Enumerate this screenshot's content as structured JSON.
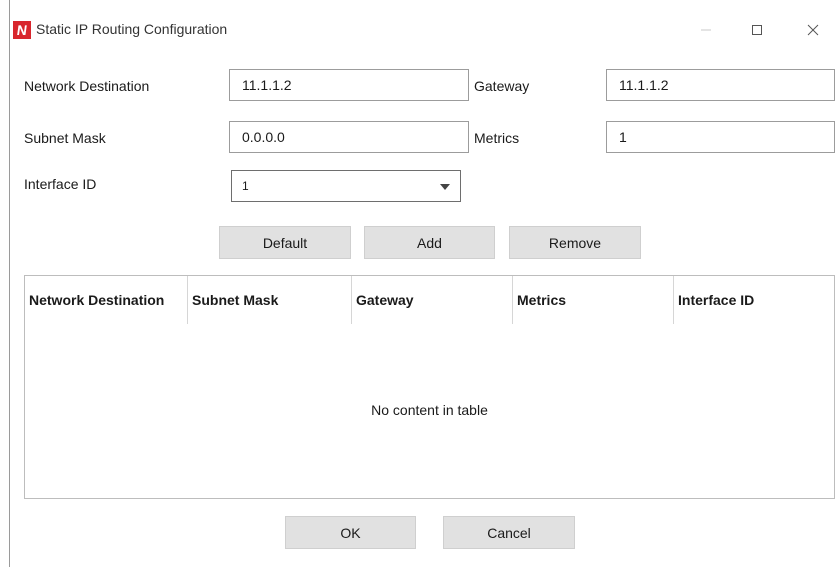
{
  "window": {
    "title": "Static IP Routing Configuration"
  },
  "form": {
    "network_destination": {
      "label": "Network Destination",
      "value": "11.1.1.2"
    },
    "gateway": {
      "label": "Gateway",
      "value": "11.1.1.2"
    },
    "subnet_mask": {
      "label": "Subnet Mask",
      "value": "0.0.0.0"
    },
    "metrics": {
      "label": "Metrics",
      "value": "1"
    },
    "interface_id": {
      "label": "Interface ID",
      "value": "1"
    }
  },
  "actions": {
    "default_label": "Default",
    "add_label": "Add",
    "remove_label": "Remove"
  },
  "table": {
    "columns": [
      "Network Destination",
      "Subnet Mask",
      "Gateway",
      "Metrics",
      "Interface ID"
    ],
    "rows": [],
    "empty_message": "No content in table"
  },
  "footer": {
    "ok_label": "OK",
    "cancel_label": "Cancel"
  },
  "colors": {
    "brand": "#d8262d",
    "button_bg": "#e1e1e1",
    "border": "#9c9c9c"
  },
  "icons": {
    "app": "app-logo-icon",
    "minimize": "minimize-icon",
    "maximize": "maximize-icon",
    "close": "close-icon",
    "dropdown": "chevron-down-icon"
  }
}
